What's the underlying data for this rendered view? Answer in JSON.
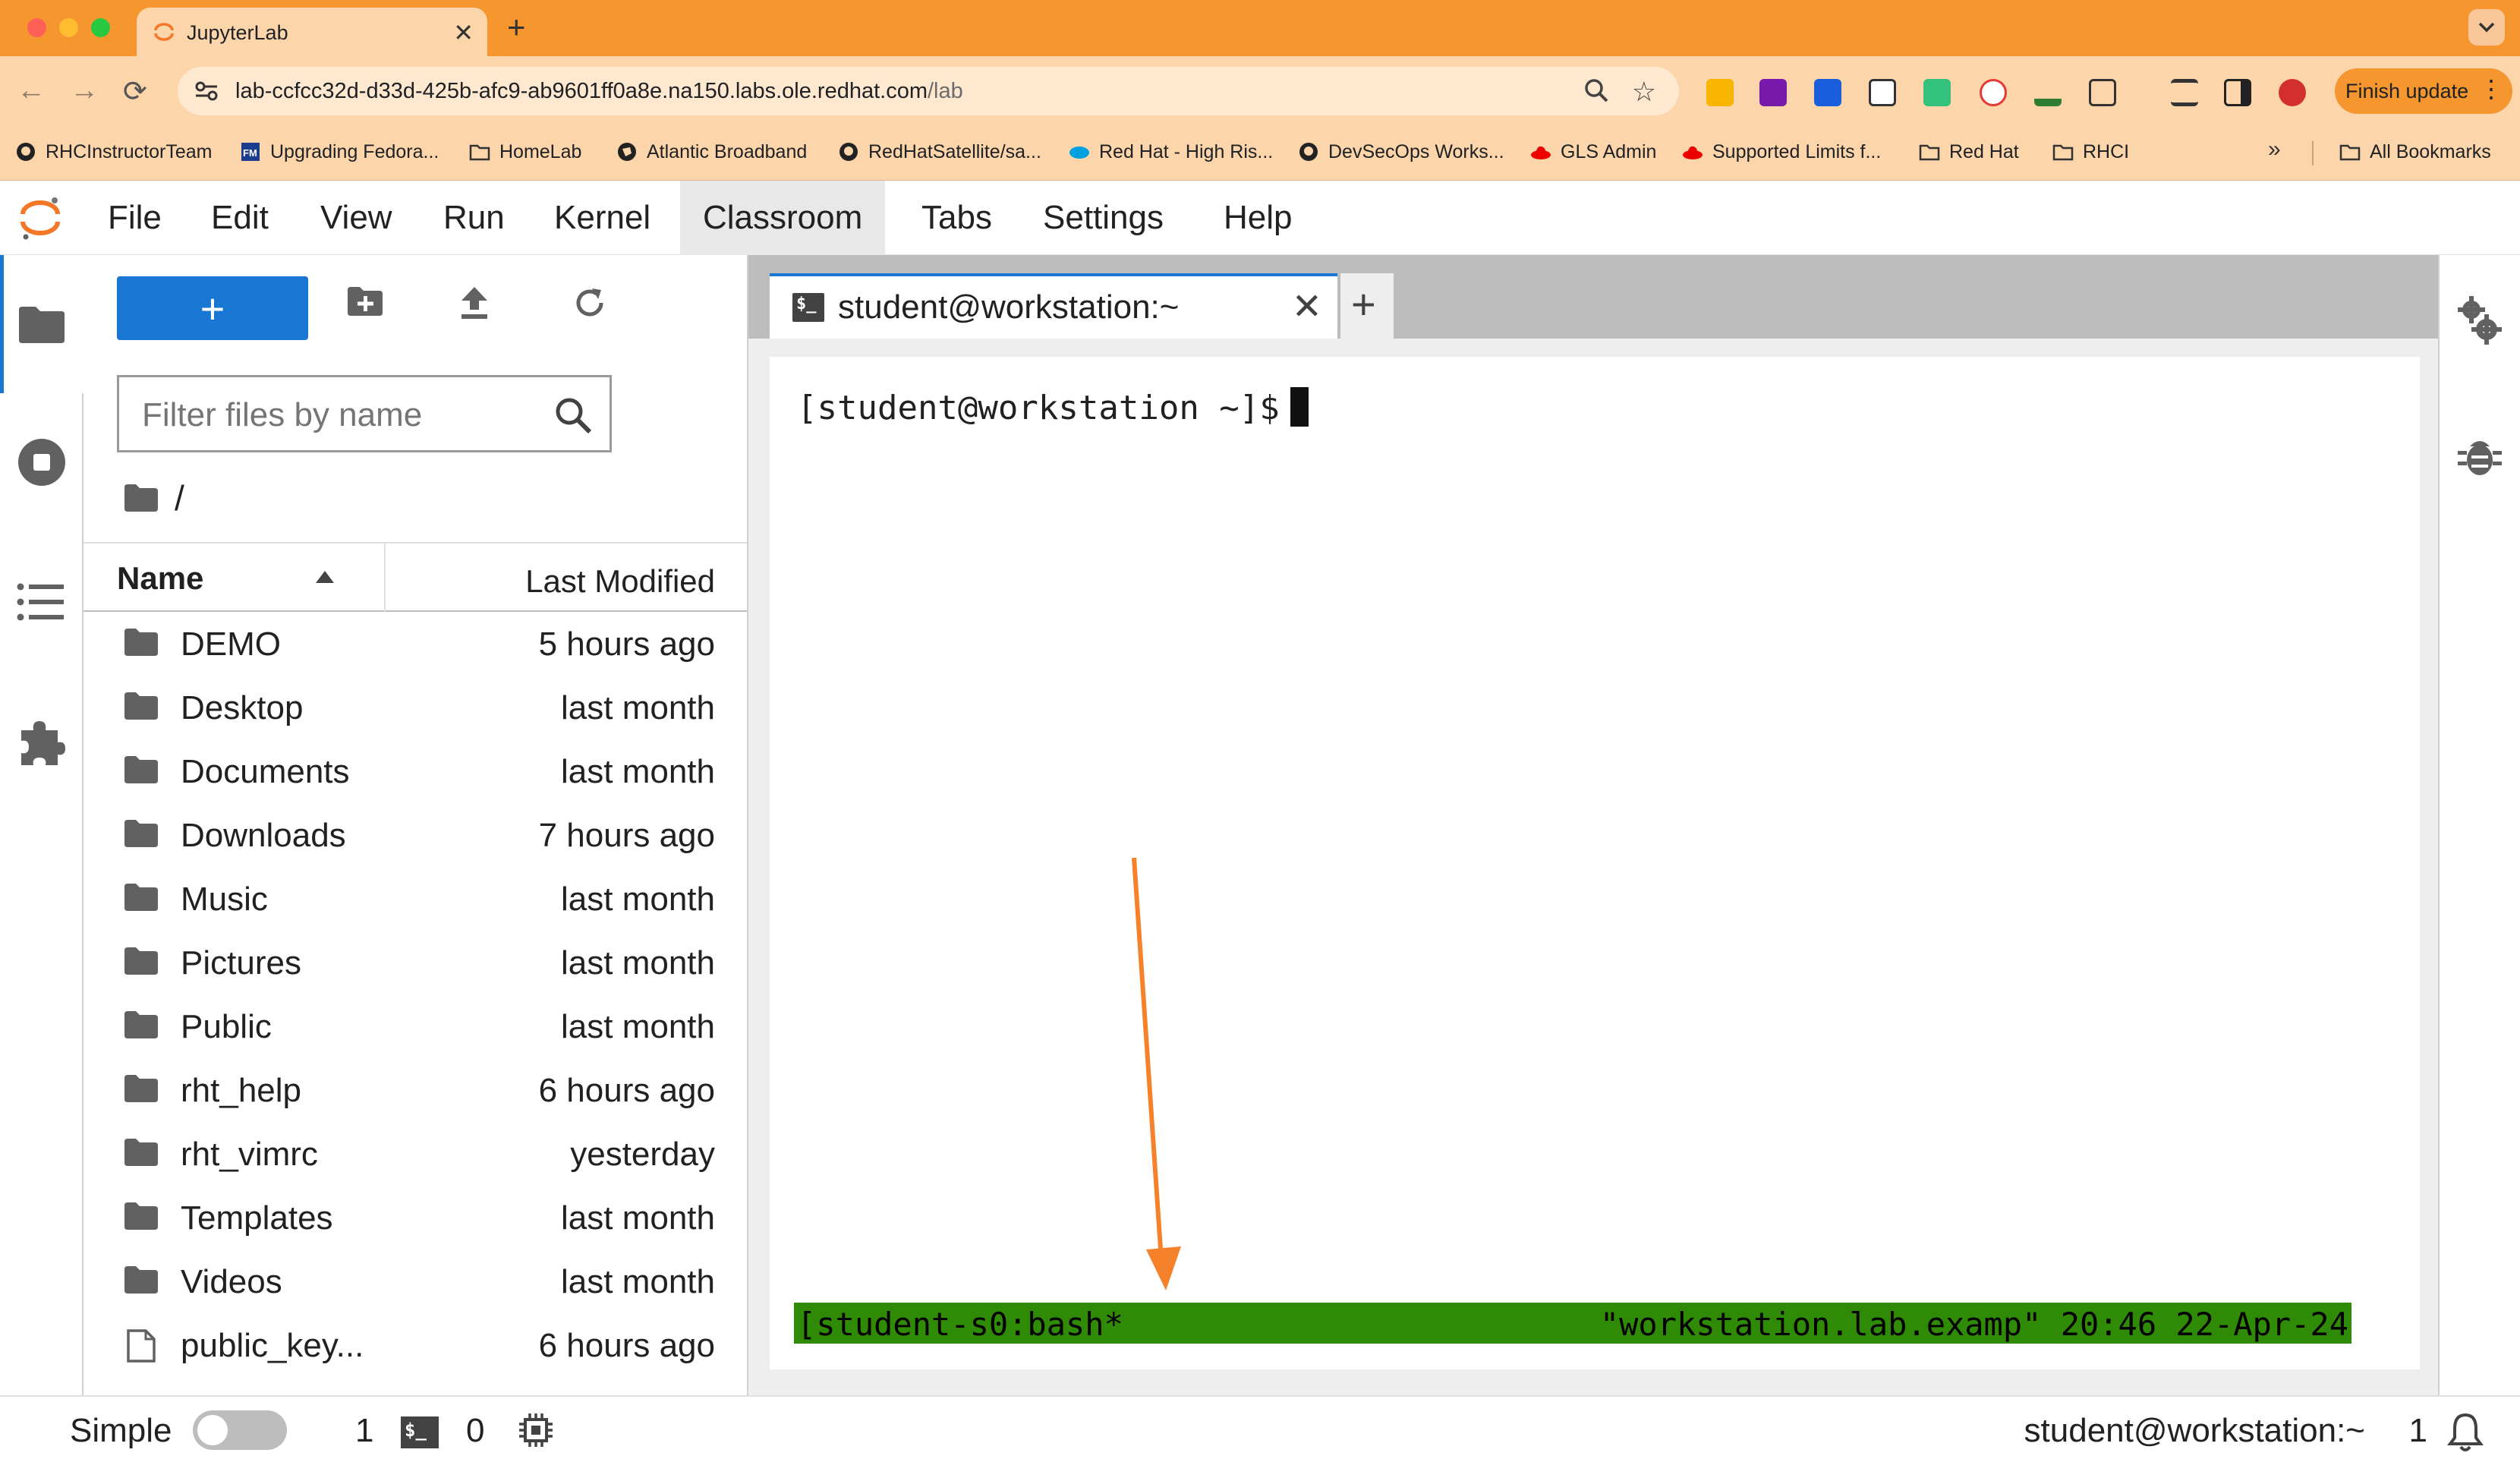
{
  "browser": {
    "tab_title": "JupyterLab",
    "url_host": "lab-ccfcc32d-d33d-425b-afc9-ab9601ff0a8e.na150.labs.ole.redhat.com",
    "url_path": "/lab",
    "finish_update_label": "Finish update",
    "bookmarks": [
      {
        "label": "RHCInstructorTeam",
        "icon": "github-icon"
      },
      {
        "label": "Upgrading Fedora...",
        "icon": "fm-icon"
      },
      {
        "label": "HomeLab",
        "icon": "folder-icon"
      },
      {
        "label": "Atlantic Broadband",
        "icon": "globe-icon"
      },
      {
        "label": "RedHatSatellite/sa...",
        "icon": "github-icon"
      },
      {
        "label": "Red Hat - High Ris...",
        "icon": "salesforce-icon"
      },
      {
        "label": "DevSecOps Works...",
        "icon": "github-icon"
      },
      {
        "label": "GLS Admin",
        "icon": "redhat-icon"
      },
      {
        "label": "Supported Limits f...",
        "icon": "redhat-icon"
      },
      {
        "label": "Red Hat",
        "icon": "folder-icon"
      },
      {
        "label": "RHCI",
        "icon": "folder-icon"
      }
    ],
    "all_bookmarks_label": "All Bookmarks"
  },
  "menubar": {
    "items": [
      "File",
      "Edit",
      "View",
      "Run",
      "Kernel",
      "Classroom",
      "Tabs",
      "Settings",
      "Help"
    ],
    "active": "Classroom"
  },
  "filebrowser": {
    "new_button_label": "+",
    "filter_placeholder": "Filter files by name",
    "breadcrumb": "/",
    "header_name": "Name",
    "header_modified": "Last Modified",
    "items": [
      {
        "name": "DEMO",
        "modified": "5 hours ago",
        "type": "folder"
      },
      {
        "name": "Desktop",
        "modified": "last month",
        "type": "folder"
      },
      {
        "name": "Documents",
        "modified": "last month",
        "type": "folder"
      },
      {
        "name": "Downloads",
        "modified": "7 hours ago",
        "type": "folder"
      },
      {
        "name": "Music",
        "modified": "last month",
        "type": "folder"
      },
      {
        "name": "Pictures",
        "modified": "last month",
        "type": "folder"
      },
      {
        "name": "Public",
        "modified": "last month",
        "type": "folder"
      },
      {
        "name": "rht_help",
        "modified": "6 hours ago",
        "type": "folder"
      },
      {
        "name": "rht_vimrc",
        "modified": "yesterday",
        "type": "folder"
      },
      {
        "name": "Templates",
        "modified": "last month",
        "type": "folder"
      },
      {
        "name": "Videos",
        "modified": "last month",
        "type": "folder"
      },
      {
        "name": "public_key...",
        "modified": "6 hours ago",
        "type": "file"
      }
    ]
  },
  "terminal": {
    "tab_label": "student@workstation:~",
    "tab_icon_text": "$_",
    "prompt": "[student@workstation ~]$",
    "tmux_left": "[student-s0:bash*",
    "tmux_right": "\"workstation.lab.examp\" 20:46 22-Apr-24",
    "tmux_color": "#2f8a05"
  },
  "statusbar": {
    "simple_label": "Simple",
    "simple_enabled": false,
    "terminal_count": "1",
    "kernel_count": "0",
    "session": "student@workstation:~",
    "notification_count": "1"
  },
  "colors": {
    "browser_accent": "#f5962f",
    "jupyter_brand": "#f37726",
    "primary": "#1976d2",
    "annotation_arrow": "#f5822a"
  }
}
